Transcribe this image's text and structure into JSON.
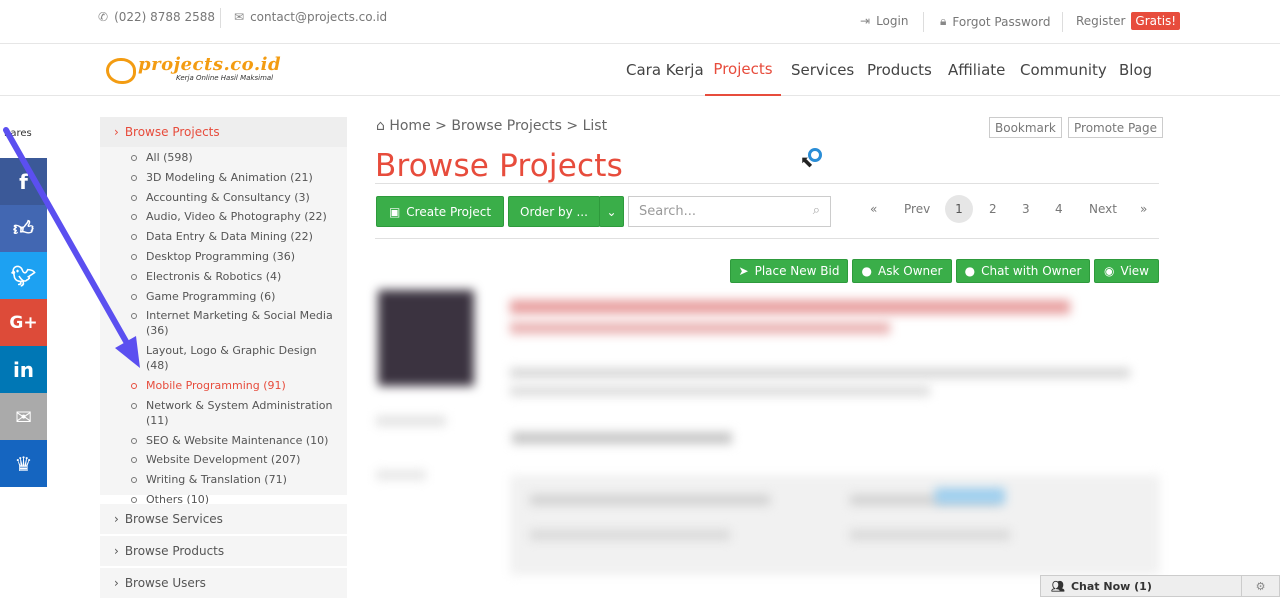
{
  "topbar": {
    "phone": "(022) 8788 2588",
    "email": "contact@projects.co.id",
    "login": "Login",
    "forgot": "Forgot Password",
    "register": "Register",
    "gratis": "Gratis!"
  },
  "brand": {
    "name": "projects.co.id",
    "tagline": "Kerja Online Hasil Maksimal"
  },
  "nav": [
    "Cara Kerja",
    "Projects",
    "Services",
    "Products",
    "Affiliate",
    "Community",
    "Blog"
  ],
  "share": {
    "label": "hares"
  },
  "social_icons": [
    "facebook-icon",
    "like-icon",
    "twitter-icon",
    "google-plus-icon",
    "linkedin-icon",
    "email-icon",
    "crown-icon"
  ],
  "social_colors": [
    "#3b5998",
    "#4267b2",
    "#1da1f2",
    "#dd4b39",
    "#0077b5",
    "#aaaaaa",
    "#1565c0"
  ],
  "sidebar": {
    "browse_projects": "Browse Projects",
    "categories": [
      "All (598)",
      "3D Modeling & Animation (21)",
      "Accounting & Consultancy (3)",
      "Audio, Video & Photography (22)",
      "Data Entry & Data Mining (22)",
      "Desktop Programming (36)",
      "Electronis & Robotics (4)",
      "Game Programming (6)",
      "Internet Marketing & Social Media (36)",
      "Layout, Logo & Graphic Design (48)",
      "Mobile Programming (91)",
      "Network & System Administration (11)",
      "SEO & Website Maintenance (10)",
      "Website Development (207)",
      "Writing & Translation (71)",
      "Others (10)"
    ],
    "selected_index": 10,
    "browse_services": "Browse Services",
    "browse_products": "Browse Products",
    "browse_users": "Browse Users"
  },
  "breadcrumb": {
    "home": "Home",
    "sep1": ">",
    "browse": "Browse Projects",
    "sep2": ">",
    "list": "List"
  },
  "bookmark": "Bookmark",
  "promote": "Promote Page",
  "page_title": "Browse Projects",
  "toolbar": {
    "create": "Create Project",
    "order": "Order by ...",
    "search_placeholder": "Search..."
  },
  "pagination": {
    "first": "«",
    "prev": "Prev",
    "pages": [
      "1",
      "2",
      "3",
      "4"
    ],
    "current": "1",
    "next": "Next",
    "last": "»"
  },
  "actions": {
    "bid": "Place New Bid",
    "ask": "Ask Owner",
    "chat": "Chat with Owner",
    "view": "View"
  },
  "chat": {
    "label": "Chat Now (1)"
  },
  "colors": {
    "accent": "#e74c3c",
    "green": "#3aae49",
    "arrow": "#5b4ff0"
  }
}
